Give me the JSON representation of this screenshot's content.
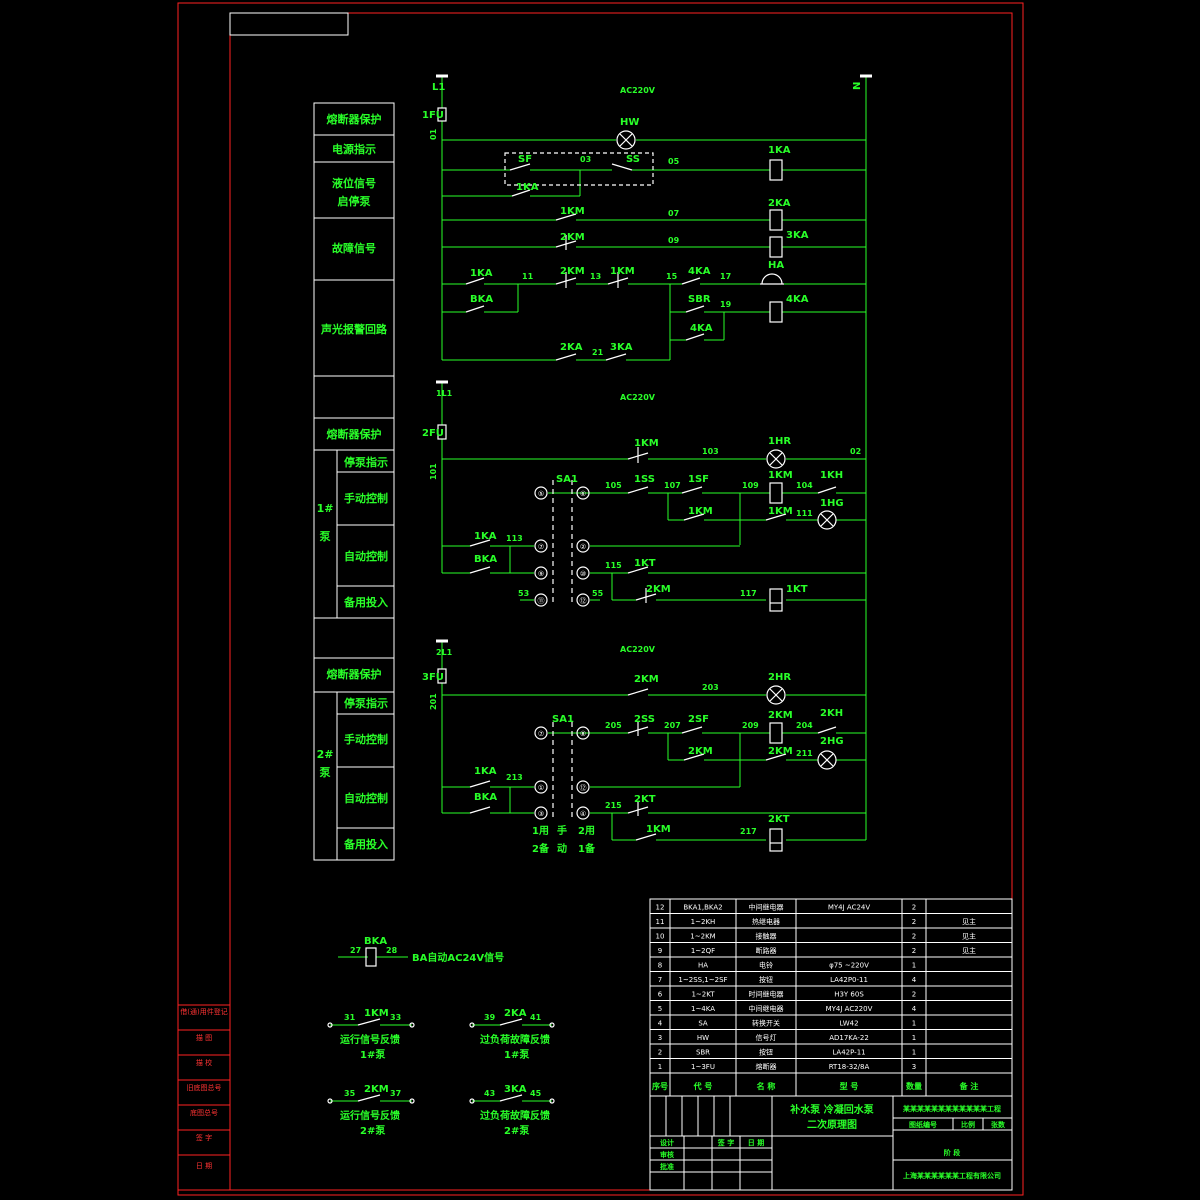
{
  "colors": {
    "background": "#000000",
    "frame": "#ff2222",
    "wire": "#29ff29",
    "device": "#ffffff",
    "text": "#29ff29"
  },
  "rails": {
    "L1": "L1",
    "N": "N",
    "v1": "AC220V",
    "m1": "1L1",
    "v2": "AC220V",
    "m2": "2L1",
    "v3": "AC220V",
    "fu1": "1FU",
    "fu2": "2FU",
    "fu3": "3FU",
    "n01": "01",
    "n101": "101",
    "n201": "201"
  },
  "side_blocks": {
    "b1": "熔断器保护",
    "b2": "电源指示",
    "b3a": "液位信号",
    "b3b": "启停泵",
    "b4": "故障信号",
    "b5": "声光报警回路",
    "b6": "熔断器保护",
    "pump1": "1#",
    "pump1b": "泵",
    "s1": "停泵指示",
    "s2": "手动控制",
    "s3": "自动控制",
    "s4": "备用投入",
    "b7": "熔断器保护",
    "pump2": "2#",
    "pump2b": "泵",
    "t1": "停泵指示",
    "t2": "手动控制",
    "t3": "自动控制",
    "t4": "备用投入"
  },
  "labels": {
    "HW": "HW",
    "SF": "SF",
    "SS": "SS",
    "n03": "03",
    "n05": "05",
    "k1KA": "1KA",
    "k1KAb": "1KA",
    "k1KM": "1KM",
    "n07": "07",
    "k2KA": "2KA",
    "k2KM": "2KM",
    "n09": "09",
    "k3KA": "3KA",
    "k1KAc": "1KA",
    "n11": "11",
    "k2KMb": "2KM",
    "n13": "13",
    "k1KMb": "1KM",
    "n15": "15",
    "k4KA": "4KA",
    "n17": "17",
    "HA": "HA",
    "BKA": "BKA",
    "SBR": "SBR",
    "n19": "19",
    "k4KAb": "4KA",
    "k4KAc": "4KA",
    "k2KAb": "2KA",
    "n21": "21",
    "k3KAb": "3KA",
    "p1KM": "1KM",
    "n103": "103",
    "HR1": "1HR",
    "n02": "02",
    "SA1": "SA1",
    "n105": "105",
    "SS1": "1SS",
    "n107": "107",
    "SF1": "1SF",
    "n109": "109",
    "KM1c": "1KM",
    "n104": "104",
    "KH1": "1KH",
    "HG1": "1HG",
    "KM1d": "1KM",
    "KM1e": "1KM",
    "n111": "111",
    "KA1p": "1KA",
    "n113": "113",
    "BKAp": "BKA",
    "n115": "115",
    "KT1": "1KT",
    "KM2p": "2KM",
    "n117": "117",
    "KT1c": "1KT",
    "n53": "53",
    "n55": "55",
    "p2KM": "2KM",
    "n203": "203",
    "HR2": "2HR",
    "SA1b": "SA1",
    "n205": "205",
    "SS2": "2SS",
    "n207": "207",
    "SF2": "2SF",
    "n209": "209",
    "KM2c": "2KM",
    "n204": "204",
    "KH2": "2KH",
    "KM2d": "2KM",
    "KM2e": "2KM",
    "n211": "211",
    "HG2": "2HG",
    "KA1q": "1KA",
    "n213": "213",
    "BKAq": "BKA",
    "n215": "215",
    "KT2": "2KT",
    "KM1q": "1KM",
    "n217": "217",
    "KT2c": "2KT",
    "s1a": "1用",
    "s1b": "2备",
    "sm1": "手",
    "sm2": "动",
    "s2a": "2用",
    "s2b": "1备",
    "c1": "①",
    "c2": "②",
    "c3": "③",
    "c5": "⑤",
    "c6": "⑥",
    "c7": "⑦",
    "c8": "⑧",
    "c9": "⑨",
    "c10": "⑩",
    "c11": "⑪",
    "c12": "⑫",
    "c4": "④"
  },
  "aux": {
    "BKA": "BKA",
    "n27": "27",
    "n28": "28",
    "ba_text": "BA自动AC24V信号",
    "n31": "31",
    "k1KM": "1KM",
    "n33": "33",
    "run1": "运行信号反馈",
    "run1b": "1#泵",
    "n39": "39",
    "k2KA": "2KA",
    "n41": "41",
    "ov1": "过负荷故障反馈",
    "ov1b": "1#泵",
    "n35": "35",
    "k2KM": "2KM",
    "n37": "37",
    "run2": "运行信号反馈",
    "run2b": "2#泵",
    "n43": "43",
    "k3KA": "3KA",
    "n45": "45",
    "ov2": "过负荷故障反馈",
    "ov2b": "2#泵"
  },
  "bom": {
    "rows": [
      {
        "no": "12",
        "code": "BKA1,BKA2",
        "name": "中间继电器",
        "model": "MY4J AC24V",
        "qty": "2",
        "note": ""
      },
      {
        "no": "11",
        "code": "1~2KH",
        "name": "热继电器",
        "model": "",
        "qty": "2",
        "note": "见主"
      },
      {
        "no": "10",
        "code": "1~2KM",
        "name": "接触器",
        "model": "",
        "qty": "2",
        "note": "见主"
      },
      {
        "no": "9",
        "code": "1~2QF",
        "name": "断路器",
        "model": "",
        "qty": "2",
        "note": "见主"
      },
      {
        "no": "8",
        "code": "HA",
        "name": "电铃",
        "model": "φ75 ~220V",
        "qty": "1",
        "note": ""
      },
      {
        "no": "7",
        "code": "1~2SS,1~2SF",
        "name": "按钮",
        "model": "LA42P0-11",
        "qty": "4",
        "note": ""
      },
      {
        "no": "6",
        "code": "1~2KT",
        "name": "时间继电器",
        "model": "H3Y 60S",
        "qty": "2",
        "note": ""
      },
      {
        "no": "5",
        "code": "1~4KA",
        "name": "中间继电器",
        "model": "MY4J AC220V",
        "qty": "4",
        "note": ""
      },
      {
        "no": "4",
        "code": "SA",
        "name": "转换开关",
        "model": "LW42",
        "qty": "1",
        "note": ""
      },
      {
        "no": "3",
        "code": "HW",
        "name": "信号灯",
        "model": "AD17KA-22",
        "qty": "1",
        "note": ""
      },
      {
        "no": "2",
        "code": "SBR",
        "name": "按钮",
        "model": "LA42P-11",
        "qty": "1",
        "note": ""
      },
      {
        "no": "1",
        "code": "1~3FU",
        "name": "熔断器",
        "model": "RT18-32/8A",
        "qty": "3",
        "note": ""
      }
    ],
    "header": {
      "no": "序号",
      "code": "代 号",
      "name": "名 称",
      "model": "型 号",
      "qty": "数量",
      "note": "备 注"
    }
  },
  "title_block": {
    "title1": "补水泵 冷凝回水泵",
    "title2": "二次原理图",
    "proj": "某某某某某某某某某某某某工程",
    "design_no": "图纸编号",
    "scale": "比例",
    "sheet": "张数",
    "company": "上海某某某某某某工程有限公司",
    "r1": "设计",
    "r2": "审核",
    "r3": "批准",
    "sign": "签 字",
    "date": "日 期",
    "stage": "阶 段"
  },
  "left_strip": {
    "a": "借(通)用件登记",
    "b": "描 图",
    "c": "描 校",
    "d": "旧底图总号",
    "e": "底图总号",
    "f": "签 字",
    "g": "日 期"
  }
}
